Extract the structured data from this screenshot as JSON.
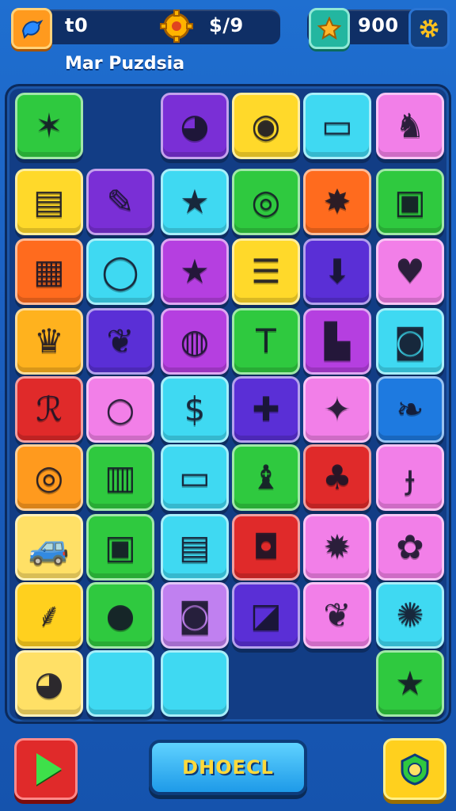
{
  "hud": {
    "left_value": "t0",
    "center_value": "$/9",
    "right_value": "900",
    "left_icon": "bird-icon",
    "center_icon": "gear-coin-icon",
    "right_icon": "star-icon",
    "settings_icon": "gear-icon"
  },
  "subtitle": "Mar Puzdsia",
  "board": {
    "tiles": [
      {
        "row": 0,
        "col": 0,
        "color": "#2fc93f",
        "icon": "bird-icon",
        "glyph": "✶"
      },
      {
        "row": 0,
        "col": 2,
        "color": "#7a2fd6",
        "icon": "globe-icon",
        "glyph": "◕"
      },
      {
        "row": 0,
        "col": 3,
        "color": "#ffd92a",
        "icon": "apple-icon",
        "glyph": "◉"
      },
      {
        "row": 0,
        "col": 4,
        "color": "#3fd9f2",
        "icon": "chat-icon",
        "glyph": "▭"
      },
      {
        "row": 0,
        "col": 5,
        "color": "#f27fe8",
        "icon": "cat-icon",
        "glyph": "♞"
      },
      {
        "row": 1,
        "col": 0,
        "color": "#ffd92a",
        "icon": "radio-icon",
        "glyph": "▤"
      },
      {
        "row": 1,
        "col": 1,
        "color": "#7a2fd6",
        "icon": "rocket-icon",
        "glyph": "✎"
      },
      {
        "row": 1,
        "col": 2,
        "color": "#3fd9f2",
        "icon": "star-icon",
        "glyph": "★"
      },
      {
        "row": 1,
        "col": 3,
        "color": "#2fc93f",
        "icon": "speech-bubble-icon",
        "glyph": "◎"
      },
      {
        "row": 1,
        "col": 4,
        "color": "#ff6b1e",
        "icon": "burst-icon",
        "glyph": "✸"
      },
      {
        "row": 1,
        "col": 5,
        "color": "#2fc93f",
        "icon": "bag-icon",
        "glyph": "▣"
      },
      {
        "row": 2,
        "col": 0,
        "color": "#ff6b1e",
        "icon": "camera-box-icon",
        "glyph": "▦"
      },
      {
        "row": 2,
        "col": 1,
        "color": "#3fd9f2",
        "icon": "ring-icon",
        "glyph": "◯"
      },
      {
        "row": 2,
        "col": 2,
        "color": "#b53fe0",
        "icon": "star-icon",
        "glyph": "★"
      },
      {
        "row": 2,
        "col": 3,
        "color": "#ffd92a",
        "icon": "list-icon",
        "glyph": "☰"
      },
      {
        "row": 2,
        "col": 4,
        "color": "#5a2fd6",
        "icon": "arrow-down-icon",
        "glyph": "⬇"
      },
      {
        "row": 2,
        "col": 5,
        "color": "#f27fe8",
        "icon": "heart-icon",
        "glyph": "♥"
      },
      {
        "row": 3,
        "col": 0,
        "color": "#ffb21e",
        "icon": "crown-icon",
        "glyph": "♛"
      },
      {
        "row": 3,
        "col": 1,
        "color": "#5a2fd6",
        "icon": "leaf-icon",
        "glyph": "❦"
      },
      {
        "row": 3,
        "col": 2,
        "color": "#b53fe0",
        "icon": "pin-icon",
        "glyph": "◍"
      },
      {
        "row": 3,
        "col": 3,
        "color": "#2fc93f",
        "icon": "letter-t-icon",
        "glyph": "T"
      },
      {
        "row": 3,
        "col": 4,
        "color": "#b53fe0",
        "icon": "puzzle-icon",
        "glyph": "▙"
      },
      {
        "row": 3,
        "col": 5,
        "color": "#3fd9f2",
        "icon": "camera-icon",
        "glyph": "◙"
      },
      {
        "row": 4,
        "col": 0,
        "color": "#e02a2a",
        "icon": "squiggle-icon",
        "glyph": "ℛ"
      },
      {
        "row": 4,
        "col": 1,
        "color": "#f27fe8",
        "icon": "bubble-icon",
        "glyph": "○"
      },
      {
        "row": 4,
        "col": 2,
        "color": "#3fd9f2",
        "icon": "dollar-icon",
        "glyph": "$"
      },
      {
        "row": 4,
        "col": 3,
        "color": "#5a2fd6",
        "icon": "plus-icon",
        "glyph": "✚"
      },
      {
        "row": 4,
        "col": 4,
        "color": "#f27fe8",
        "icon": "sparkle-icon",
        "glyph": "✦"
      },
      {
        "row": 4,
        "col": 5,
        "color": "#1e7ae0",
        "icon": "flame-icon",
        "glyph": "❧"
      },
      {
        "row": 5,
        "col": 0,
        "color": "#ff9a1e",
        "icon": "lens-icon",
        "glyph": "◎"
      },
      {
        "row": 5,
        "col": 1,
        "color": "#2fc93f",
        "icon": "building-icon",
        "glyph": "▥"
      },
      {
        "row": 5,
        "col": 2,
        "color": "#3fd9f2",
        "icon": "laptop-icon",
        "glyph": "▭"
      },
      {
        "row": 5,
        "col": 3,
        "color": "#2fc93f",
        "icon": "chess-piece-icon",
        "glyph": "♝"
      },
      {
        "row": 5,
        "col": 4,
        "color": "#e02a2a",
        "icon": "clover-icon",
        "glyph": "♣"
      },
      {
        "row": 5,
        "col": 5,
        "color": "#f27fe8",
        "icon": "feather-icon",
        "glyph": "ɟ"
      },
      {
        "row": 6,
        "col": 0,
        "color": "#ffe066",
        "icon": "car-icon",
        "glyph": "🚙"
      },
      {
        "row": 6,
        "col": 1,
        "color": "#2fc93f",
        "icon": "radio-icon",
        "glyph": "▣"
      },
      {
        "row": 6,
        "col": 2,
        "color": "#3fd9f2",
        "icon": "notepad-icon",
        "glyph": "▤"
      },
      {
        "row": 6,
        "col": 3,
        "color": "#e02a2a",
        "icon": "camera-icon",
        "glyph": "◘"
      },
      {
        "row": 6,
        "col": 4,
        "color": "#f27fe8",
        "icon": "gear-icon",
        "glyph": "✹"
      },
      {
        "row": 6,
        "col": 5,
        "color": "#f27fe8",
        "icon": "flower-icon",
        "glyph": "✿"
      },
      {
        "row": 7,
        "col": 0,
        "color": "#ffd01e",
        "icon": "broom-icon",
        "glyph": "⸙"
      },
      {
        "row": 7,
        "col": 1,
        "color": "#2fc93f",
        "icon": "balloon-icon",
        "glyph": "●"
      },
      {
        "row": 7,
        "col": 2,
        "color": "#c080f0",
        "icon": "camera-icon",
        "glyph": "◙"
      },
      {
        "row": 7,
        "col": 3,
        "color": "#5a2fd6",
        "icon": "ruler-icon",
        "glyph": "◪"
      },
      {
        "row": 7,
        "col": 4,
        "color": "#f27fe8",
        "icon": "leaf-icon",
        "glyph": "❦"
      },
      {
        "row": 7,
        "col": 5,
        "color": "#3fd9f2",
        "icon": "blob-icon",
        "glyph": "✺"
      },
      {
        "row": 8,
        "col": 0,
        "color": "#ffe066",
        "icon": "creature-icon",
        "glyph": "◕"
      },
      {
        "row": 8,
        "col": 1,
        "color": "#3fd9f2",
        "icon": "empty-slot",
        "glyph": ""
      },
      {
        "row": 8,
        "col": 2,
        "color": "#3fd9f2",
        "icon": "empty-slot",
        "glyph": ""
      },
      {
        "row": 8,
        "col": 5,
        "color": "#2fc93f",
        "icon": "star-icon",
        "glyph": "★"
      }
    ]
  },
  "controls": {
    "play_icon": "play-icon",
    "main_button_label": "DHOECL",
    "hint_icon": "shield-icon",
    "hint_glyph": "⬢"
  }
}
